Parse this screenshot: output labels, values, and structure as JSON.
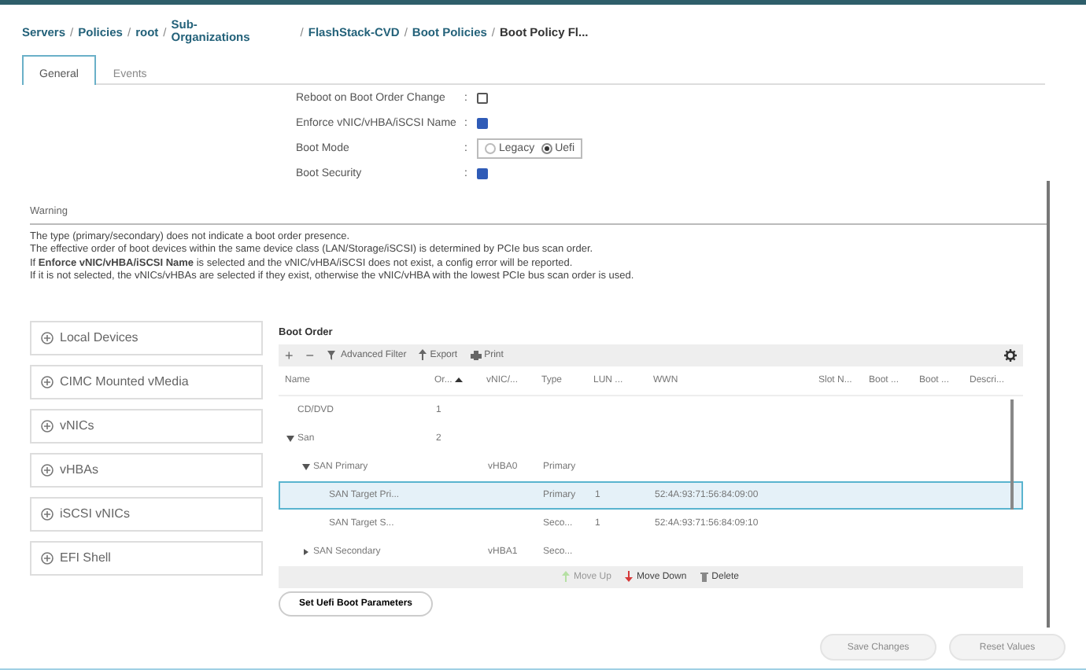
{
  "breadcrumb": [
    {
      "label": "Servers"
    },
    {
      "separator": "/",
      "label": "Policies"
    },
    {
      "separator": "/",
      "label": "root"
    },
    {
      "separator": "/",
      "label": "Sub-\nOrganizations"
    },
    {
      "separator": "/",
      "label": "FlashStack-CVD"
    },
    {
      "separator": "/",
      "label": "Boot Policies"
    },
    {
      "separator": "/",
      "label": "Boot Policy Fl..."
    }
  ],
  "tabs": [
    {
      "label": "General",
      "selected": true
    },
    {
      "label": "Events",
      "selected": false
    }
  ],
  "form": [
    {
      "kind": "checkbox",
      "label": "Reboot on Boot Order Change",
      "colon": ":",
      "checked": false
    },
    {
      "kind": "checkbox",
      "label": "Enforce vNIC/vHBA/iSCSI Name",
      "colon": ":",
      "checked": true
    },
    {
      "kind": "radio",
      "label": "Boot Mode",
      "colon": ":",
      "options": [
        {
          "label": "Legacy",
          "selected": false
        },
        {
          "label": "Uefi",
          "selected": true
        }
      ]
    },
    {
      "kind": "checkbox",
      "label": "Boot Security",
      "colon": ":",
      "checked": true
    }
  ],
  "warning": {
    "title": "Warning",
    "lines": [
      "The type (primary/secondary) does not indicate a boot order presence.",
      "The effective order of boot devices within the same device class (LAN/Storage/iSCSI) is determined by PCIe bus scan order.",
      "If **Enforce vNIC/vHBA/iSCSI Name** is selected and the vNIC/vHBA/iSCSI does not exist, a config error will be reported.",
      "If it is not selected, the vNICs/vHBAs are selected if they exist, otherwise the vNIC/vHBA with the lowest PCIe bus scan order is used."
    ]
  },
  "device_groups": [
    {
      "label": "Local Devices"
    },
    {
      "label": "CIMC Mounted vMedia"
    },
    {
      "label": "vNICs"
    },
    {
      "label": "vHBAs"
    },
    {
      "label": "iSCSI vNICs"
    },
    {
      "label": "EFI Shell"
    }
  ],
  "boot_order": {
    "title": "Boot Order",
    "toolbar": [
      {
        "kind": "add",
        "label": "+"
      },
      {
        "kind": "remove",
        "label": "−"
      },
      {
        "kind": "filter",
        "label": "Advanced Filter"
      },
      {
        "kind": "export",
        "label": "Export"
      },
      {
        "kind": "print",
        "label": "Print"
      }
    ],
    "columns": [
      {
        "label": "Name"
      },
      {
        "label": "Or...",
        "sorted": true
      },
      {
        "label": "vNIC/..."
      },
      {
        "label": "Type"
      },
      {
        "label": "LUN ..."
      },
      {
        "label": "WWN"
      },
      {
        "label": "Slot N..."
      },
      {
        "label": "Boot ..."
      },
      {
        "label": "Boot ..."
      },
      {
        "label": "Descri..."
      }
    ],
    "rows": [
      {
        "cells": [
          "CD/DVD",
          "1",
          "",
          "",
          "",
          ""
        ],
        "selected": false
      },
      {
        "cells": [
          "San",
          "2",
          "",
          "",
          "",
          ""
        ],
        "selected": false,
        "expanded": true,
        "children": [
          {
            "cells": [
              "SAN Primary",
              "",
              "vHBA0",
              "Primary",
              "",
              ""
            ],
            "selected": false,
            "expanded": true,
            "children": [
              {
                "cells": [
                  "SAN Target Pri...",
                  "",
                  "",
                  "Primary",
                  "1",
                  "52:4A:93:71:56:84:09:00"
                ],
                "selected": true
              },
              {
                "cells": [
                  "SAN Target S...",
                  "",
                  "",
                  "Seco...",
                  "1",
                  "52:4A:93:71:56:84:09:10"
                ],
                "selected": false
              }
            ]
          },
          {
            "cells": [
              "SAN Secondary",
              "",
              "vHBA1",
              "Seco...",
              "",
              ""
            ],
            "selected": false,
            "expanded": false
          }
        ]
      }
    ],
    "actions": [
      {
        "kind": "up",
        "label": "Move Up",
        "disabled": true
      },
      {
        "kind": "down",
        "label": "Move Down",
        "disabled": false
      },
      {
        "kind": "delete",
        "label": "Delete",
        "disabled": false
      }
    ],
    "button": "Set Uefi Boot Parameters"
  },
  "footer_buttons": [
    {
      "label": "Save Changes",
      "disabled": true
    },
    {
      "label": "Reset Values",
      "disabled": true
    }
  ]
}
